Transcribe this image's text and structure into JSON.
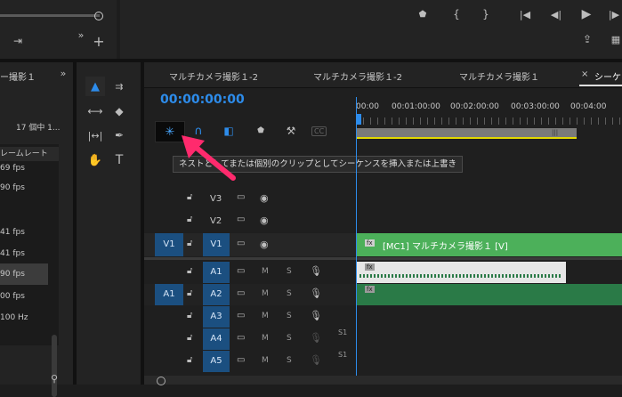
{
  "top": {
    "transport_icons": [
      "marker-icon",
      "in-point-icon",
      "out-point-icon",
      "go-to-in-icon",
      "step-back-icon",
      "play-icon",
      "step-forward-icon"
    ],
    "right_row2_icons": [
      "export-frame-icon",
      "multicam-icon"
    ]
  },
  "project": {
    "title_partial": "ー撮影１",
    "count": "17 個中 1...",
    "column_header": "レームレート",
    "rows": [
      "69 fps",
      "90 fps",
      "",
      "41 fps",
      "41 fps",
      "90 fps",
      "00 fps",
      "100 Hz"
    ]
  },
  "tools": [
    "selection-tool",
    "track-select-tool",
    "ripple-edit-tool",
    "razor-tool",
    "slip-tool",
    "pen-tool",
    "hand-tool",
    "type-tool"
  ],
  "timeline": {
    "tabs": [
      "マルチカメラ撮影１-2",
      "マルチカメラ撮影１-2",
      "マルチカメラ撮影１",
      "シーケ"
    ],
    "tab_close": "×",
    "timecode": "00:00:00:00",
    "ruler": [
      "00:00",
      "00:01:00:00",
      "00:02:00:00",
      "00:03:00:00",
      "00:04:00"
    ],
    "tooltip": "ネストとしてまたは個別のクリップとしてシーケンスを挿入または上書き",
    "cc_label": "CC",
    "video_tracks": [
      {
        "src": "",
        "name": "V3"
      },
      {
        "src": "",
        "name": "V2"
      },
      {
        "src": "V1",
        "name": "V1"
      }
    ],
    "audio_tracks": [
      {
        "src": "",
        "name": "A1",
        "m": "M",
        "s": "S"
      },
      {
        "src": "A1",
        "name": "A2",
        "m": "M",
        "s": "S"
      },
      {
        "src": "",
        "name": "A3",
        "m": "M",
        "s": "S"
      },
      {
        "src": "",
        "name": "A4",
        "m": "M",
        "s": "S"
      },
      {
        "src": "",
        "name": "A5",
        "m": "M",
        "s": "S"
      }
    ],
    "clip_label": "[MC1] マルチカメラ撮影１ [V]",
    "fx_label": "fx",
    "s1_label": "S1",
    "colors": {
      "accent": "#2d8ceb",
      "video_clip": "#4cb05a",
      "audio_clip": "#2a7a47",
      "arrow": "#ff2a6d"
    }
  }
}
